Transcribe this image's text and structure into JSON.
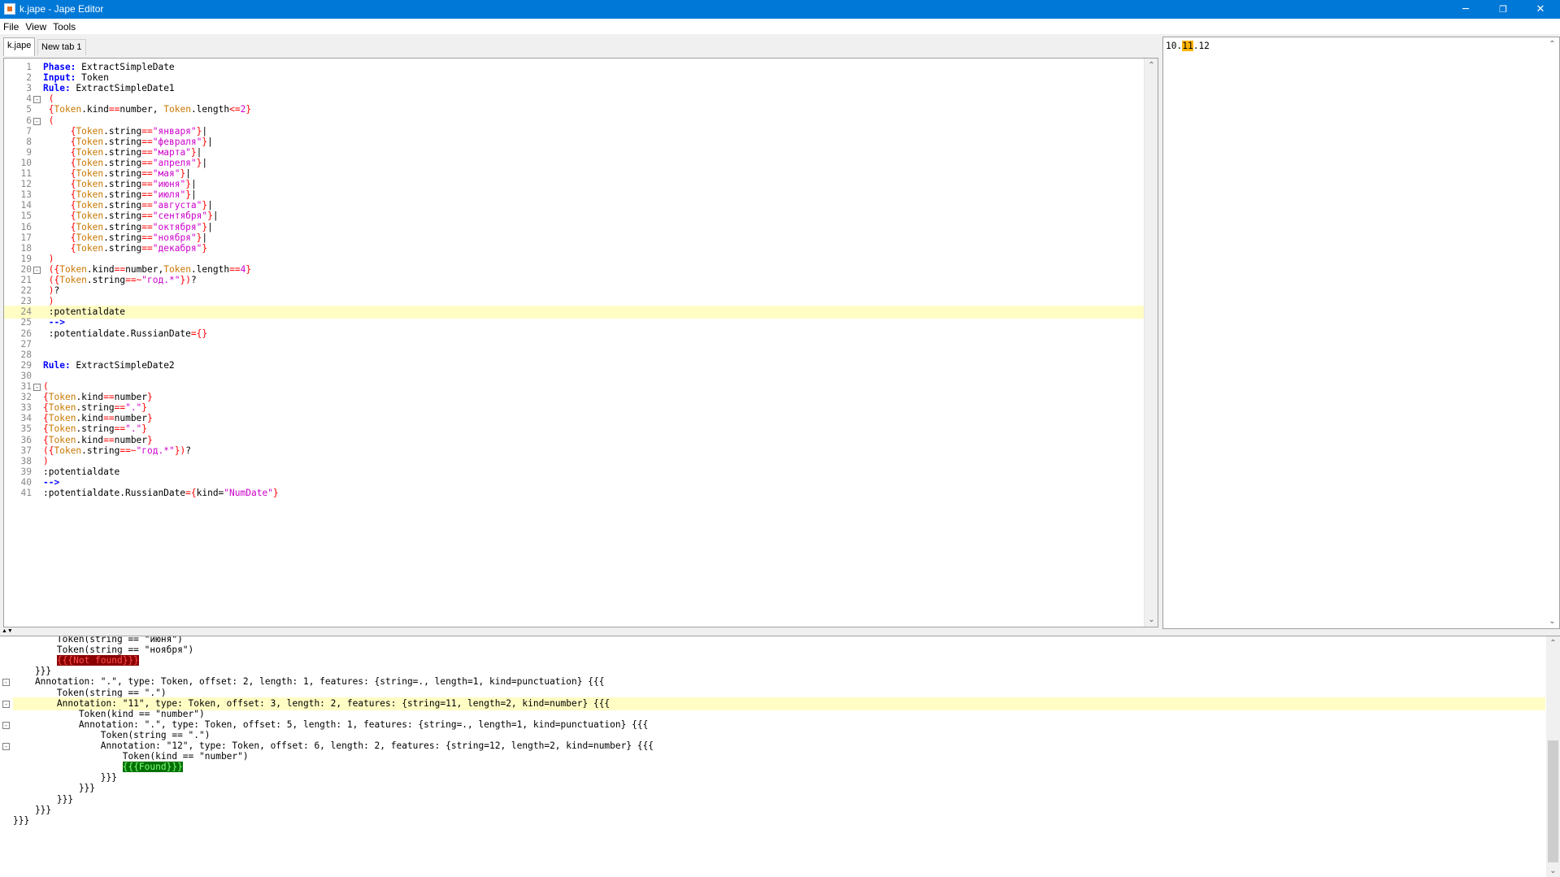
{
  "window": {
    "title": "k.jape - Jape Editor",
    "minimize": "─",
    "restore": "❐",
    "close": "✕"
  },
  "menu": [
    "File",
    "View",
    "Tools"
  ],
  "tabs": [
    {
      "label": "k.jape",
      "active": true
    },
    {
      "label": "New tab 1",
      "active": false
    }
  ],
  "editor": {
    "lines": [
      {
        "n": "1",
        "fold": "",
        "html": "<span class='kw'>Phase:</span> ExtractSimpleDate"
      },
      {
        "n": "2",
        "fold": "",
        "html": "<span class='kw'>Input:</span> Token"
      },
      {
        "n": "3",
        "fold": "",
        "html": "<span class='kw'>Rule:</span> ExtractSimpleDate1"
      },
      {
        "n": "4",
        "fold": "-",
        "html": " <span class='brk'>(</span>"
      },
      {
        "n": "5",
        "fold": "",
        "html": " <span class='brk'>{</span><span class='tok'>Token</span>.kind<span class='brk'>==</span>number, <span class='tok'>Token</span>.length<span class='brk'>&lt;=</span><span class='str'>2</span><span class='brk'>}</span>"
      },
      {
        "n": "6",
        "fold": "-",
        "html": " <span class='brk'>(</span>"
      },
      {
        "n": "7",
        "fold": "",
        "html": "     <span class='brk'>{</span><span class='tok'>Token</span>.string<span class='brk'>==</span><span class='str'>\"января\"</span><span class='brk'>}</span>|"
      },
      {
        "n": "8",
        "fold": "",
        "html": "     <span class='brk'>{</span><span class='tok'>Token</span>.string<span class='brk'>==</span><span class='str'>\"февраля\"</span><span class='brk'>}</span>|"
      },
      {
        "n": "9",
        "fold": "",
        "html": "     <span class='brk'>{</span><span class='tok'>Token</span>.string<span class='brk'>==</span><span class='str'>\"марта\"</span><span class='brk'>}</span>|"
      },
      {
        "n": "10",
        "fold": "",
        "html": "     <span class='brk'>{</span><span class='tok'>Token</span>.string<span class='brk'>==</span><span class='str'>\"апреля\"</span><span class='brk'>}</span>|"
      },
      {
        "n": "11",
        "fold": "",
        "html": "     <span class='brk'>{</span><span class='tok'>Token</span>.string<span class='brk'>==</span><span class='str'>\"мая\"</span><span class='brk'>}</span>|"
      },
      {
        "n": "12",
        "fold": "",
        "html": "     <span class='brk'>{</span><span class='tok'>Token</span>.string<span class='brk'>==</span><span class='str'>\"июня\"</span><span class='brk'>}</span>|"
      },
      {
        "n": "13",
        "fold": "",
        "html": "     <span class='brk'>{</span><span class='tok'>Token</span>.string<span class='brk'>==</span><span class='str'>\"июля\"</span><span class='brk'>}</span>|"
      },
      {
        "n": "14",
        "fold": "",
        "html": "     <span class='brk'>{</span><span class='tok'>Token</span>.string<span class='brk'>==</span><span class='str'>\"августа\"</span><span class='brk'>}</span>|"
      },
      {
        "n": "15",
        "fold": "",
        "html": "     <span class='brk'>{</span><span class='tok'>Token</span>.string<span class='brk'>==</span><span class='str'>\"сентября\"</span><span class='brk'>}</span>|"
      },
      {
        "n": "16",
        "fold": "",
        "html": "     <span class='brk'>{</span><span class='tok'>Token</span>.string<span class='brk'>==</span><span class='str'>\"октября\"</span><span class='brk'>}</span>|"
      },
      {
        "n": "17",
        "fold": "",
        "html": "     <span class='brk'>{</span><span class='tok'>Token</span>.string<span class='brk'>==</span><span class='str'>\"ноября\"</span><span class='brk'>}</span>|"
      },
      {
        "n": "18",
        "fold": "",
        "html": "     <span class='brk'>{</span><span class='tok'>Token</span>.string<span class='brk'>==</span><span class='str'>\"декабря\"</span><span class='brk'>}</span>"
      },
      {
        "n": "19",
        "fold": "",
        "html": " <span class='brk'>)</span>"
      },
      {
        "n": "20",
        "fold": "-",
        "html": " <span class='brk'>({</span><span class='tok'>Token</span>.kind<span class='brk'>==</span>number,<span class='tok'>Token</span>.length<span class='brk'>==</span><span class='str'>4</span><span class='brk'>}</span>"
      },
      {
        "n": "21",
        "fold": "",
        "html": " <span class='brk'>({</span><span class='tok'>Token</span>.string<span class='brk'>==~</span><span class='str'>\"год.*\"</span><span class='brk'>})</span>?"
      },
      {
        "n": "22",
        "fold": "",
        "html": " <span class='brk'>)</span>?"
      },
      {
        "n": "23",
        "fold": "",
        "html": " <span class='brk'>)</span>"
      },
      {
        "n": "24",
        "fold": "",
        "html": " :potentialdate",
        "hl": true
      },
      {
        "n": "25",
        "fold": "",
        "html": " <span class='arrow'>--&gt;</span>"
      },
      {
        "n": "26",
        "fold": "",
        "html": " :potentialdate.RussianDate<span class='brk'>={}</span>"
      },
      {
        "n": "27",
        "fold": "",
        "html": ""
      },
      {
        "n": "28",
        "fold": "",
        "html": ""
      },
      {
        "n": "29",
        "fold": "",
        "html": "<span class='kw'>Rule:</span> ExtractSimpleDate2"
      },
      {
        "n": "30",
        "fold": "",
        "html": ""
      },
      {
        "n": "31",
        "fold": "-",
        "html": "<span class='brk'>(</span>"
      },
      {
        "n": "32",
        "fold": "",
        "html": "<span class='brk'>{</span><span class='tok'>Token</span>.kind<span class='brk'>==</span>number<span class='brk'>}</span>"
      },
      {
        "n": "33",
        "fold": "",
        "html": "<span class='brk'>{</span><span class='tok'>Token</span>.string<span class='brk'>==</span><span class='str'>\".\"</span><span class='brk'>}</span>"
      },
      {
        "n": "34",
        "fold": "",
        "html": "<span class='brk'>{</span><span class='tok'>Token</span>.kind<span class='brk'>==</span>number<span class='brk'>}</span>"
      },
      {
        "n": "35",
        "fold": "",
        "html": "<span class='brk'>{</span><span class='tok'>Token</span>.string<span class='brk'>==</span><span class='str'>\".\"</span><span class='brk'>}</span>"
      },
      {
        "n": "36",
        "fold": "",
        "html": "<span class='brk'>{</span><span class='tok'>Token</span>.kind<span class='brk'>==</span>number<span class='brk'>}</span>"
      },
      {
        "n": "37",
        "fold": "",
        "html": "<span class='brk'>({</span><span class='tok'>Token</span>.string<span class='brk'>==~</span><span class='str'>\"год.*\"</span><span class='brk'>})</span>?"
      },
      {
        "n": "38",
        "fold": "",
        "html": "<span class='brk'>)</span>"
      },
      {
        "n": "39",
        "fold": "",
        "html": ":potentialdate"
      },
      {
        "n": "40",
        "fold": "",
        "html": "<span class='arrow'>--&gt;</span>"
      },
      {
        "n": "41",
        "fold": "",
        "html": ":potentialdate.RussianDate<span class='brk'>={</span>kind=<span class='str'>\"NumDate\"</span><span class='brk'>}</span>"
      }
    ]
  },
  "input_pane": {
    "before": "10.",
    "highlighted": "11",
    "after": ".12"
  },
  "output": {
    "lines": [
      {
        "fold": "",
        "hl": false,
        "html": "        Token(string == \"июня\")"
      },
      {
        "fold": "",
        "hl": false,
        "html": "        Token(string == \"ноября\")"
      },
      {
        "fold": "",
        "hl": false,
        "html": "        <span class='nf'>{{{Not found}}}</span>"
      },
      {
        "fold": "",
        "hl": false,
        "html": "    }}}"
      },
      {
        "fold": "-",
        "hl": false,
        "html": "    Annotation: \".\", type: Token, offset: 2, length: 1, features: {string=., length=1, kind=punctuation} {{{"
      },
      {
        "fold": "",
        "hl": false,
        "html": "        Token(string == \".\")"
      },
      {
        "fold": "-",
        "hl": true,
        "html": "        Annotation: \"11\", type: Token, offset: 3, length: 2, features: {string=11, length=2, kind=number} {{{"
      },
      {
        "fold": "",
        "hl": false,
        "html": "            Token(kind == \"number\")"
      },
      {
        "fold": "-",
        "hl": false,
        "html": "            Annotation: \".\", type: Token, offset: 5, length: 1, features: {string=., length=1, kind=punctuation} {{{"
      },
      {
        "fold": "",
        "hl": false,
        "html": "                Token(string == \".\")"
      },
      {
        "fold": "-",
        "hl": false,
        "html": "                Annotation: \"12\", type: Token, offset: 6, length: 2, features: {string=12, length=2, kind=number} {{{"
      },
      {
        "fold": "",
        "hl": false,
        "html": "                    Token(kind == \"number\")"
      },
      {
        "fold": "",
        "hl": false,
        "html": "                    <span class='fd'>{{{Found}}}</span>"
      },
      {
        "fold": "",
        "hl": false,
        "html": "                }}}"
      },
      {
        "fold": "",
        "hl": false,
        "html": "            }}}"
      },
      {
        "fold": "",
        "hl": false,
        "html": "        }}}"
      },
      {
        "fold": "",
        "hl": false,
        "html": "    }}}"
      },
      {
        "fold": "",
        "hl": false,
        "html": "}}}"
      }
    ]
  },
  "scroll": {
    "up": "⌃",
    "down": "⌄"
  }
}
